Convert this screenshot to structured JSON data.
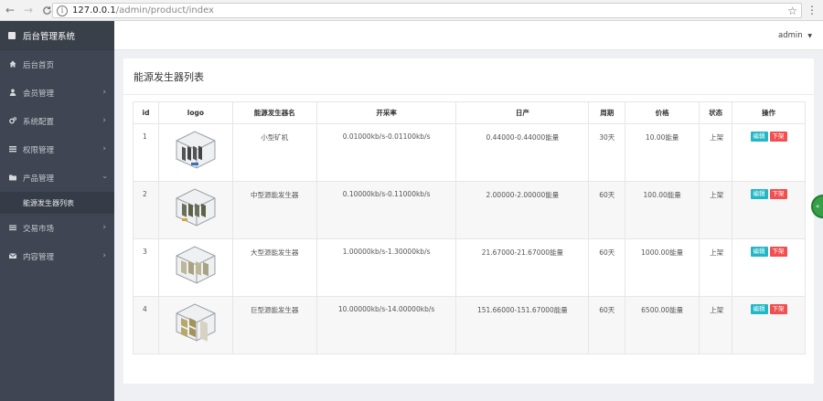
{
  "browser": {
    "back_icon": "←",
    "forward_icon": "→",
    "reload_icon": "C",
    "url_host": "127.0.0.1",
    "url_path": "/admin/product/index",
    "star_icon": "☆",
    "menu_icon": "⋮"
  },
  "sidebar": {
    "brand": "后台管理系统",
    "items": [
      {
        "label": "后台首页",
        "icon": "home-icon",
        "has_children": false
      },
      {
        "label": "会员管理",
        "icon": "user-icon",
        "has_children": true
      },
      {
        "label": "系统配置",
        "icon": "cogs-icon",
        "has_children": true
      },
      {
        "label": "权限管理",
        "icon": "list-icon",
        "has_children": true
      },
      {
        "label": "产品管理",
        "icon": "folder-icon",
        "has_children": true,
        "expanded": true
      },
      {
        "label": "交易市场",
        "icon": "bars-icon",
        "has_children": true
      },
      {
        "label": "内容管理",
        "icon": "mail-icon",
        "has_children": true
      }
    ],
    "subitem": "能源发生器列表"
  },
  "header": {
    "user": "admin"
  },
  "main": {
    "title": "能源发生器列表",
    "columns": [
      "id",
      "logo",
      "能源发生器名",
      "开采率",
      "日产",
      "周期",
      "价格",
      "状态",
      "操作"
    ],
    "rows": [
      {
        "id": "1",
        "name": "小型矿机",
        "rate": "0.01000kb/s-0.01100kb/s",
        "daily": "0.44000-0.44000能量",
        "period": "30天",
        "price": "10.00能量",
        "status": "上架"
      },
      {
        "id": "2",
        "name": "中型源能发生器",
        "rate": "0.10000kb/s-0.11000kb/s",
        "daily": "2.00000-2.00000能量",
        "period": "60天",
        "price": "100.00能量",
        "status": "上架"
      },
      {
        "id": "3",
        "name": "大型源能发生器",
        "rate": "1.00000kb/s-1.30000kb/s",
        "daily": "21.67000-21.67000能量",
        "period": "60天",
        "price": "1000.00能量",
        "status": "上架"
      },
      {
        "id": "4",
        "name": "巨型源能发生器",
        "rate": "10.00000kb/s-14.00000kb/s",
        "daily": "151.66000-151.67000能量",
        "period": "60天",
        "price": "6500.00能量",
        "status": "上架"
      }
    ],
    "edit_label": "编辑",
    "off_label": "下架"
  },
  "colors": {
    "sidebar_bg": "#3f4552",
    "edit_btn": "#23b7c5",
    "off_btn": "#f05050",
    "float_widget": "#35a047"
  }
}
